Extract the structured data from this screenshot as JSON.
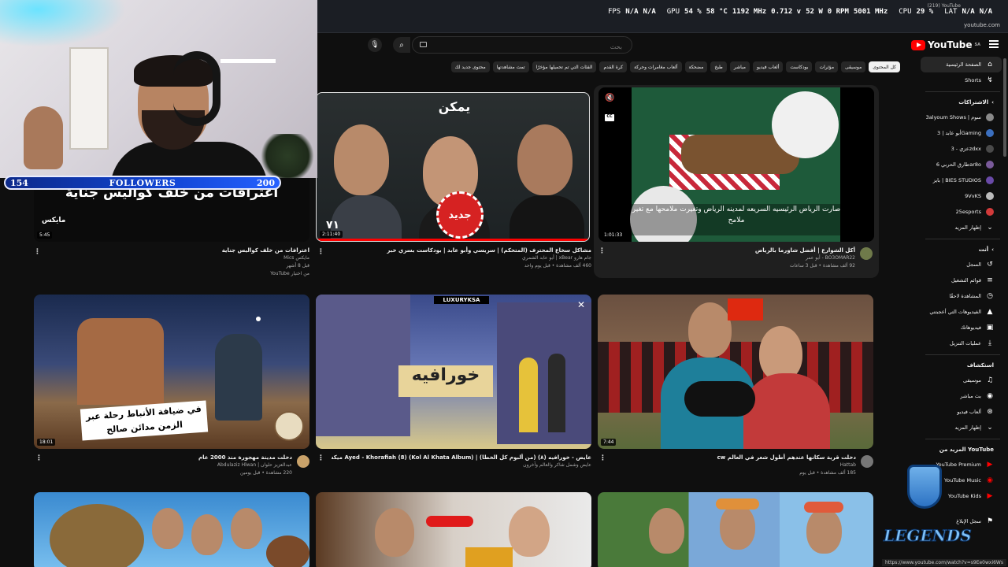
{
  "hud": {
    "tab_title": "(219) YouTube",
    "stats": [
      "FPS",
      "N/A",
      "N/A",
      "GPU",
      "54 %",
      "58 °C",
      "1192 MHz",
      "0.712 v",
      "52 W",
      "0 RPM",
      "5001 MHz",
      "CPU",
      "29 %",
      "LAT",
      "N/A",
      "N/A"
    ],
    "url": "youtube.com"
  },
  "overlay": {
    "followers_current": "154",
    "followers_label": "FOLLOWERS",
    "followers_goal": "200"
  },
  "masthead": {
    "logo": "YouTube",
    "logo_sup": "SA",
    "search_placeholder": "بحث"
  },
  "chips": [
    "كل المحتوى",
    "موسيقى",
    "مؤثرات",
    "بودكاست",
    "ألعاب فيديو",
    "مباشر",
    "طبخ",
    "مضحكة",
    "ألعاب مغامرات وحركة",
    "كرة القدم",
    "الفئات التي تم تحميلها مؤخرًا",
    "تمت مشاهدتها",
    "محتوى جديد لك"
  ],
  "sidebar": {
    "main": [
      {
        "label": "الصفحة الرئيسية",
        "icon": "home-icon",
        "glyph": "⌂"
      },
      {
        "label": "Shorts",
        "icon": "shorts-icon",
        "glyph": "↯"
      }
    ],
    "subs_title": "الاشتراكات",
    "subs": [
      {
        "label": "3alyoum Shows | سوم",
        "color": "#8a8a8a"
      },
      {
        "label": "أبو عابد | 3Gaming",
        "color": "#3b6fbf"
      },
      {
        "label": "عزي - 3zdxx",
        "color": "#4a4a4a"
      },
      {
        "label": "طارق الحربي 6ar8o",
        "color": "#7a5a9a"
      },
      {
        "label": "بايز | BIES STUDIOS",
        "color": "#6a4aa8"
      },
      {
        "label": "9VvKS",
        "color": "#bbbbbb"
      },
      {
        "label": "25esports",
        "color": "#d23a3a"
      },
      {
        "label": "إظهار المزيد",
        "color": "#333333"
      }
    ],
    "you_title": "أنت",
    "you": [
      {
        "label": "السجل",
        "icon": "history-icon",
        "glyph": "↺"
      },
      {
        "label": "قوائم التشغيل",
        "icon": "playlist-icon",
        "glyph": "≡"
      },
      {
        "label": "المشاهدة لاحقًا",
        "icon": "watch-later-icon",
        "glyph": "◷"
      },
      {
        "label": "الفيديوهات التي أعجبتني",
        "icon": "like-icon",
        "glyph": "👍"
      },
      {
        "label": "فيديوهاتك",
        "icon": "your-videos-icon",
        "glyph": "▣"
      },
      {
        "label": "عمليات التنزيل",
        "icon": "download-icon",
        "glyph": "⤓"
      }
    ],
    "explore_title": "استكشاف",
    "explore": [
      {
        "label": "موسيقى",
        "icon": "music-icon",
        "glyph": "♫"
      },
      {
        "label": "بث مباشر",
        "icon": "live-icon",
        "glyph": "◉"
      },
      {
        "label": "ألعاب فيديو",
        "icon": "gaming-icon",
        "glyph": "⊛"
      },
      {
        "label": "إظهار المزيد",
        "icon": "chevron-down-icon",
        "glyph": "⌄"
      }
    ],
    "more_title": "المزيد من YouTube",
    "more": [
      {
        "label": "YouTube Premium",
        "icon": "premium-icon"
      },
      {
        "label": "YouTube Music",
        "icon": "yt-music-icon"
      },
      {
        "label": "YouTube Kids",
        "icon": "yt-kids-icon"
      }
    ],
    "settings": "سجل الإبلاغ"
  },
  "videos": [
    {
      "title": "اعترافات من خلف كواليس جناية",
      "channel": "مايكس Mics",
      "stats": "قبل 8 أشهر",
      "extra": "من اختيار YouTube",
      "badge": "جديد",
      "duration": "5:45",
      "overlay_text": "اعترافات من خلف كواليس جناية"
    },
    {
      "title": "مشاكل سخاع المحترف (المتحكم) | سريسي وأبو عابد | بودكاست بسري خبر",
      "channel": "جام هارو xBear | أبو عابد الشمري",
      "stats": "460 ألف مشاهدة • قبل يوم واحد",
      "duration": "2:11:40",
      "badge": "جديد",
      "overlay_text": "٧١"
    },
    {
      "title": "أكل الشوارع | أفضل شاورما بالرياض",
      "channel": "BO3OMAR22 - أبو عمر",
      "stats": "92 ألف مشاهدة • قبل 3 ساعات",
      "duration": "1:01:33",
      "overlay_text": "صارت الرياض الرئيسيه السريعه لمدينه الرياض وتغيرت ملامحها مع تغير ملامح"
    },
    {
      "title": "دخلت مدينة مهجورة منذ 2000 عام",
      "channel": "عبدالعزيز حلوان | Abdulaziz Hlwan",
      "stats": "220 مشاهدة • قبل يومين",
      "duration": "18:01",
      "overlay_text": "في ضيافة الأنباط رحلة عبر الزمن مدائن صالح"
    },
    {
      "title": "عايض - خورافيه (٨) (من ألبوم كل الخطا) | Ayed - Khorafiah (8) (Kol Al Khata Album) ميكس",
      "channel": "عايض وشمل شاكر والعالم وآخرون",
      "stats": "",
      "duration": "",
      "overlay_text": "خورافيه",
      "brand": "LUXURYKSA"
    },
    {
      "title": "دخلت قرية سكانها عندهم أطول شعر في العالم cw",
      "channel": "Hattab",
      "stats": "185 ألف مشاهدة • قبل يوم",
      "duration": "7:44",
      "overlay_text": ""
    },
    {
      "title": "",
      "channel": "",
      "stats": "",
      "duration": "",
      "overlay_text": ""
    },
    {
      "title": "",
      "channel": "",
      "stats": "",
      "duration": "",
      "overlay_text": ""
    },
    {
      "title": "",
      "channel": "",
      "stats": "",
      "duration": "",
      "overlay_text": ""
    }
  ],
  "watermark": "LEGENDS",
  "status_url": "https://www.youtube.com/watch?v=s9Ee0wxi6Ws"
}
